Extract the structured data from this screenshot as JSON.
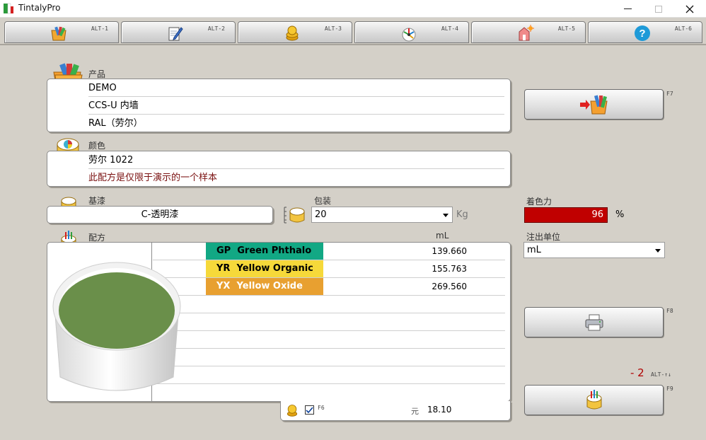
{
  "window": {
    "title": "TintalyPro"
  },
  "tabs": [
    {
      "key": "ALT-1",
      "icon": "color-fan-folder-icon"
    },
    {
      "key": "ALT-2",
      "icon": "pen-document-icon"
    },
    {
      "key": "ALT-3",
      "icon": "coins-icon"
    },
    {
      "key": "ALT-4",
      "icon": "color-wheel-dial-icon"
    },
    {
      "key": "ALT-5",
      "icon": "house-sun-icon"
    },
    {
      "key": "ALT-6",
      "icon": "help-icon"
    }
  ],
  "product": {
    "label": "产品",
    "brand": "DEMO",
    "line": "CCS-U 内墙",
    "collection": "RAL（劳尔）"
  },
  "color": {
    "label": "颜色",
    "name": "劳尔 1022",
    "note": "此配方是仅限于演示的一个样本"
  },
  "base": {
    "label": "基漆",
    "value": "C-透明漆"
  },
  "package": {
    "label": "包装",
    "value": "20",
    "unit": "Kg"
  },
  "strength": {
    "label": "着色力",
    "value": "96",
    "unit": "%"
  },
  "dispense_unit": {
    "label": "注出单位",
    "value": "mL"
  },
  "formula": {
    "label": "配方",
    "unit_header": "mL",
    "swatch_color": "#6a8f4a",
    "rows": [
      {
        "code": "GP",
        "name": "Green Phthalo",
        "amount": "139.660",
        "color": "#12a884",
        "text": "#000000"
      },
      {
        "code": "YR",
        "name": "Yellow Organic",
        "amount": "155.763",
        "color": "#f6d93a",
        "text": "#000000"
      },
      {
        "code": "YX",
        "name": "Yellow Oxide",
        "amount": "269.560",
        "color": "#e8a030",
        "text": "#ffffff"
      }
    ]
  },
  "price": {
    "key": "F6",
    "currency": "元",
    "value": "18.10",
    "checked": true
  },
  "buttons": {
    "open_key": "F7",
    "print_key": "F8",
    "dispense_key": "F9",
    "counter_value": "- 2",
    "counter_key": "ALT-↑↓"
  }
}
